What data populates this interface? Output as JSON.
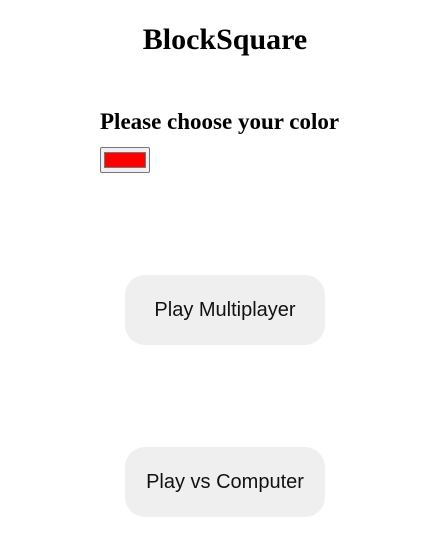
{
  "app": {
    "title": "BlockSquare"
  },
  "color_picker": {
    "label": "Please choose your color",
    "selected_color": "#ff0000"
  },
  "buttons": {
    "multiplayer": "Play Multiplayer",
    "computer": "Play vs Computer"
  },
  "colors": {
    "button_background": "#efefef",
    "text": "#000000"
  }
}
